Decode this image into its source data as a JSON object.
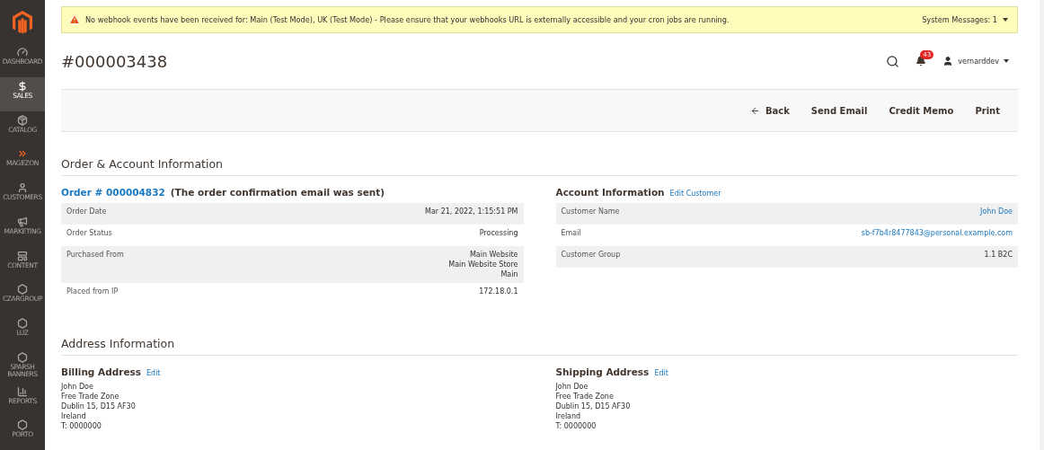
{
  "sidebar": {
    "items": [
      {
        "label": "DASHBOARD",
        "selected": false
      },
      {
        "label": "SALES",
        "selected": true
      },
      {
        "label": "CATALOG",
        "selected": false
      },
      {
        "label": "MAGEZON",
        "selected": false
      },
      {
        "label": "CUSTOMERS",
        "selected": false
      },
      {
        "label": "MARKETING",
        "selected": false
      },
      {
        "label": "CONTENT",
        "selected": false
      },
      {
        "label": "CZARGROUP",
        "selected": false
      },
      {
        "label": "LUZ",
        "selected": false
      },
      {
        "label": "SPARSH BANNERS",
        "selected": false
      },
      {
        "label": "REPORTS",
        "selected": false
      },
      {
        "label": "PORTO",
        "selected": false
      }
    ]
  },
  "system_message": {
    "text": "No webhook events have been received for: Main (Test Mode), UK (Test Mode) - Please ensure that your webhooks URL is externally accessible and your cron jobs are running.",
    "count_label": "System Messages: 1"
  },
  "page_title": "#000003438",
  "header": {
    "notifications": "43",
    "user": "vernarddev"
  },
  "actions": [
    {
      "label": "Back",
      "kind": "back"
    },
    {
      "label": "Send Email",
      "kind": "plain"
    },
    {
      "label": "Credit Memo",
      "kind": "plain"
    },
    {
      "label": "Print",
      "kind": "plain"
    }
  ],
  "order_section": {
    "title": "Order & Account Information",
    "order": {
      "link": "Order # 000004832",
      "note": "(The order confirmation email was sent)",
      "rows": [
        {
          "label": "Order Date",
          "values": [
            "Mar 21, 2022, 1:15:51 PM"
          ],
          "link": false
        },
        {
          "label": "Order Status",
          "values": [
            "Processing"
          ],
          "link": false
        },
        {
          "label": "Purchased From",
          "values": [
            "Main Website",
            "Main Website Store",
            "Main"
          ],
          "link": false
        },
        {
          "label": "Placed from IP",
          "values": [
            "172.18.0.1"
          ],
          "link": false
        }
      ]
    },
    "account": {
      "title": "Account Information",
      "edit": "Edit Customer",
      "rows": [
        {
          "label": "Customer Name",
          "values": [
            "John Doe"
          ],
          "link": true
        },
        {
          "label": "Email",
          "values": [
            "sb-f7b4r8477843@personal.example.com"
          ],
          "link": true
        },
        {
          "label": "Customer Group",
          "values": [
            "1.1 B2C"
          ],
          "link": false
        }
      ]
    }
  },
  "address_section": {
    "title": "Address Information",
    "addresses": [
      {
        "title": "Billing Address",
        "edit": "Edit",
        "lines": [
          "John Doe",
          "Free Trade Zone",
          "Dublin 15, D15 AF30",
          "Ireland",
          "T: 0000000"
        ]
      },
      {
        "title": "Shipping Address",
        "edit": "Edit",
        "lines": [
          "John Doe",
          "Free Trade Zone",
          "Dublin 15, D15 AF30",
          "Ireland",
          "T: 0000000"
        ]
      }
    ]
  }
}
